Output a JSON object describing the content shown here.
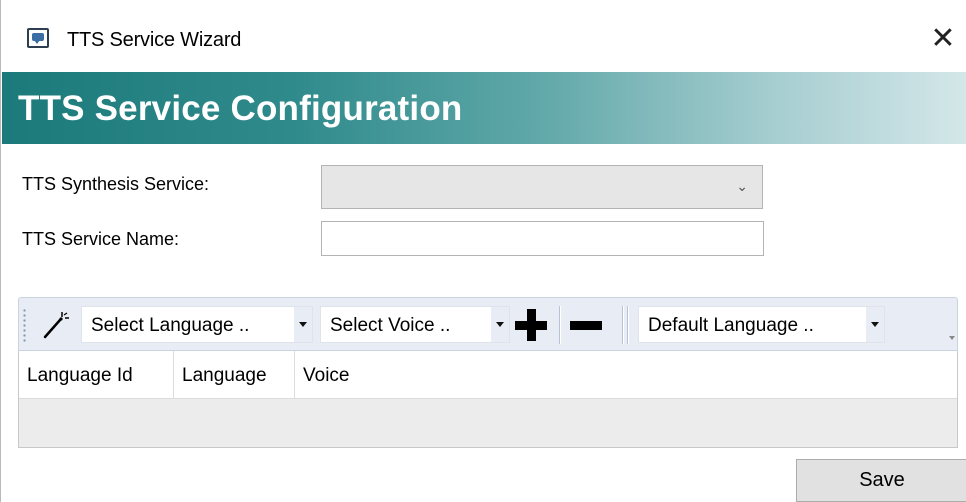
{
  "window": {
    "title": "TTS Service Wizard"
  },
  "header": {
    "title": "TTS Service Configuration"
  },
  "form": {
    "synthesis_service_label": "TTS Synthesis Service:",
    "synthesis_service_value": "",
    "service_name_label": "TTS Service Name:",
    "service_name_value": ""
  },
  "toolbar": {
    "select_language": "Select Language ..",
    "select_voice": "Select Voice ..",
    "default_language": "Default Language .."
  },
  "grid": {
    "columns": [
      "Language Id",
      "Language",
      "Voice"
    ],
    "rows": []
  },
  "footer": {
    "save_label": "Save"
  },
  "icons": {
    "app": "speech-bubble-icon",
    "close": "close-icon",
    "wizard": "magic-wand-icon",
    "add": "plus-icon",
    "remove": "minus-icon"
  },
  "colors": {
    "banner_start": "#1c7a7b",
    "banner_end": "#d4e7e9",
    "toolbar_bg": "#e8edf5"
  }
}
